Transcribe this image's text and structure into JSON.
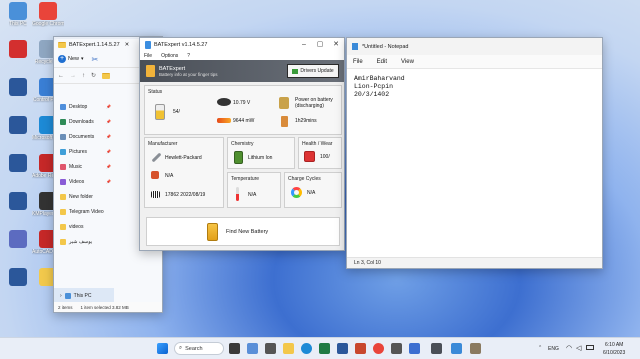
{
  "desktop": {
    "icons": [
      {
        "label": "This PC",
        "color": "#4a90d9"
      },
      {
        "label": "Google Chrome",
        "color": "#e9443a"
      },
      {
        "label": "",
        "color": "#d32f2f"
      },
      {
        "label": "Recycle Bin",
        "color": "#8fa7c2"
      },
      {
        "label": "",
        "color": "#2b579a"
      },
      {
        "label": "Control Panel",
        "color": "#3a7fd5"
      },
      {
        "label": "",
        "color": "#2b579a"
      },
      {
        "label": "Microsoft Edge",
        "color": "#1d8ad6"
      },
      {
        "label": "",
        "color": "#2b579a"
      },
      {
        "label": "Adobe Reader XI",
        "color": "#c62828"
      },
      {
        "label": "",
        "color": "#2b579a"
      },
      {
        "label": "KMPlayer 64X",
        "color": "#333333"
      },
      {
        "label": "",
        "color": "#5c6bc0"
      },
      {
        "label": "AutoCAD 2024 - E...",
        "color": "#c62828"
      },
      {
        "label": "",
        "color": "#2b579a"
      },
      {
        "label": "",
        "color": "#f2c94c"
      }
    ]
  },
  "explorer": {
    "tab_title": "BATExpert.1.14.5.27",
    "new_label": "New",
    "nav": [
      {
        "label": "Desktop",
        "color": "#4f8fdc"
      },
      {
        "label": "Downloads",
        "color": "#2e8b57"
      },
      {
        "label": "Documents",
        "color": "#6b8fb8"
      },
      {
        "label": "Pictures",
        "color": "#3f9fd8"
      },
      {
        "label": "Music",
        "color": "#e0566d"
      },
      {
        "label": "Videos",
        "color": "#8a5cd6"
      },
      {
        "label": "New folder",
        "color": "#f3c74a"
      },
      {
        "label": "Telegram Video",
        "color": "#f3c74a"
      },
      {
        "label": "videos",
        "color": "#f3c74a"
      },
      {
        "label": "یوسف شیر",
        "color": "#f3c74a"
      }
    ],
    "this_pc": "This PC",
    "status": {
      "items": "2 items",
      "selected": "1 item selected  3.82 MB"
    }
  },
  "batexpert": {
    "title": "BATExpert v1.14.5.27",
    "menu": [
      "File",
      "Options",
      "?"
    ],
    "banner": {
      "title": "BATExpert",
      "subtitle": "Battery info at your finger tips",
      "button": "Drivers Update"
    },
    "status": {
      "title": "Status",
      "percent": "54/",
      "voltage": "10.79 V",
      "power": "Power on battery (discharging)",
      "rate": "9644 mW",
      "time": "1h29mins"
    },
    "manufacturer": {
      "title": "Manufacturer",
      "name": "Hewlett-Packard",
      "model": "N/A",
      "serial": "17862 2022/08/19"
    },
    "chemistry": {
      "title": "Chemistry",
      "value": "Lithium Ion"
    },
    "health": {
      "title": "Health / Wear",
      "value": "100/"
    },
    "temperature": {
      "title": "Temperature",
      "value": "N/A"
    },
    "cycles": {
      "title": "Charge Cycles",
      "value": "N/A"
    },
    "find": "Find New Battery"
  },
  "notepad": {
    "title": "*Untitled - Notepad",
    "menu": [
      "File",
      "Edit",
      "View"
    ],
    "lines": [
      "AmirBaharvand",
      "Lion-Pcpin",
      "20/3/1402"
    ],
    "status": "Ln 3, Col 10"
  },
  "taskbar": {
    "search": "Search",
    "lang": "ENG",
    "time": "6:10 AM",
    "date": "6/10/2023"
  }
}
